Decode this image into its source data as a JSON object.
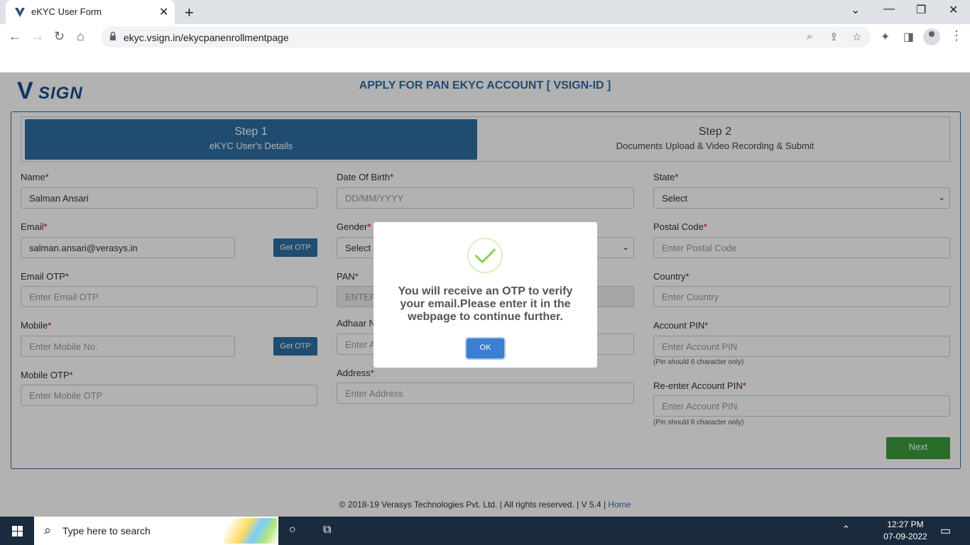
{
  "browser": {
    "tab_title": "eKYC User Form",
    "tab_close": "✕",
    "new_tab": "+",
    "url": "ekyc.vsign.in/ekycpanenrollmentpage",
    "window_controls": [
      "⌄",
      "—",
      "❐",
      "✕"
    ]
  },
  "header": {
    "logo_mark": "V",
    "logo_text": "SIGN",
    "title": "APPLY FOR PAN EKYC ACCOUNT [ VSIGN-ID ]"
  },
  "steps": {
    "step1": {
      "num": "Step 1",
      "desc": "eKYC User's Details"
    },
    "step2": {
      "num": "Step 2",
      "desc": "Documents Upload & Video Recording & Submit"
    }
  },
  "form": {
    "name": {
      "label": "Name",
      "value": "Salman Ansari"
    },
    "email": {
      "label": "Email",
      "value": "salman.ansari@verasys.in",
      "otp_button": "Get OTP"
    },
    "email_otp": {
      "label": "Email OTP",
      "placeholder": "Enter Email OTP"
    },
    "mobile": {
      "label": "Mobile",
      "placeholder": "Enter Mobile No.",
      "otp_button": "Get OTP"
    },
    "mobile_otp": {
      "label": "Mobile OTP",
      "placeholder": "Enter Mobile OTP"
    },
    "dob": {
      "label": "Date Of Birth",
      "placeholder": "DD/MM/YYYY"
    },
    "gender": {
      "label": "Gender",
      "selected": "Select"
    },
    "pan": {
      "label": "PAN",
      "placeholder": "ENTER"
    },
    "aadhaar": {
      "label": "Adhaar N",
      "placeholder": "Enter A"
    },
    "address": {
      "label": "Address",
      "placeholder": "Enter Address"
    },
    "state": {
      "label": "State",
      "selected": "Select"
    },
    "postal": {
      "label": "Postal Code",
      "placeholder": "Enter Postal Code"
    },
    "country": {
      "label": "Country",
      "placeholder": "Enter Country"
    },
    "pin": {
      "label": "Account PIN",
      "placeholder": "Enter Account PIN",
      "hint": "(Pin should 6 character only)"
    },
    "repin": {
      "label": "Re-enter Account PIN",
      "placeholder": "Enter Account PIN",
      "hint": "(Pin should 6 character only)"
    },
    "required_mark": "*",
    "next_button": "Next"
  },
  "footer": {
    "text": "©  2018-19  Verasys Technologies Pvt. Ltd. | All rights reserved. | V 5.4 | ",
    "home_link": "Home"
  },
  "modal": {
    "message": "You will receive an OTP to verify your email.Please enter it in the webpage to continue further.",
    "ok_button": "OK"
  },
  "taskbar": {
    "search_placeholder": "Type here to search",
    "time": "12:27 PM",
    "date": "07-09-2022"
  },
  "colors": {
    "accent": "#2e6da4",
    "next": "#3c9b3c",
    "required": "#cc0000"
  }
}
